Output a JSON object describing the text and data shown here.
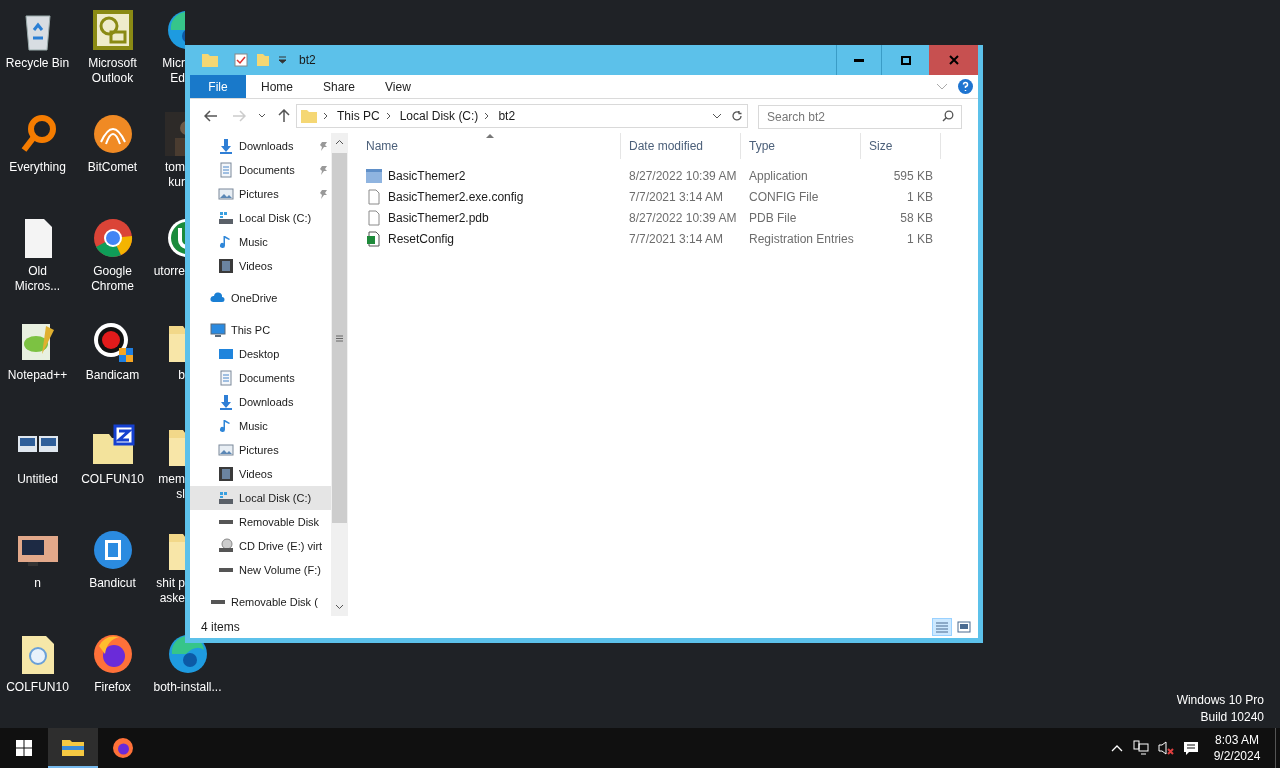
{
  "desktop": {
    "columns": [
      [
        {
          "kind": "recycle",
          "lines": [
            "Recycle Bin"
          ],
          "covered": false
        },
        {
          "kind": "everything",
          "lines": [
            "Everything"
          ],
          "covered": false
        },
        {
          "kind": "blank-doc",
          "lines": [
            "Old",
            "Micros..."
          ],
          "covered": false
        },
        {
          "kind": "notepad",
          "lines": [
            "Notepad++"
          ],
          "covered": false
        },
        {
          "kind": "screens",
          "lines": [
            "Untitled"
          ],
          "covered": false
        },
        {
          "kind": "tv",
          "lines": [
            "n"
          ],
          "covered": false
        },
        {
          "kind": "doc-folder",
          "lines": [
            "COLFUN10"
          ],
          "covered": false
        }
      ],
      [
        {
          "kind": "outlook",
          "lines": [
            "Microsoft",
            "Outlook"
          ],
          "covered": false
        },
        {
          "kind": "comet",
          "lines": [
            "BitComet"
          ],
          "covered": false
        },
        {
          "kind": "chrome",
          "lines": [
            "Google",
            "Chrome"
          ],
          "covered": false
        },
        {
          "kind": "bandicam",
          "lines": [
            "Bandicam"
          ],
          "covered": false
        },
        {
          "kind": "zip-folder",
          "lines": [
            "COLFUN10"
          ],
          "covered": false
        },
        {
          "kind": "bandicut",
          "lines": [
            "Bandicut"
          ],
          "covered": false
        },
        {
          "kind": "firefox",
          "lines": [
            "Firefox"
          ],
          "covered": false
        }
      ],
      [
        {
          "kind": "edge",
          "lines": [
            "Micr",
            "Ed"
          ],
          "covered": true
        },
        {
          "kind": "photo",
          "lines": [
            "tom",
            "kur"
          ],
          "covered": true
        },
        {
          "kind": "utorrent",
          "lines": [
            "utorre"
          ],
          "covered": true
        },
        {
          "kind": "folder",
          "lines": [
            "b"
          ],
          "covered": true
        },
        {
          "kind": "folder",
          "lines": [
            "mem",
            "sl"
          ],
          "covered": true
        },
        {
          "kind": "folder",
          "lines": [
            "shit p",
            "aske"
          ],
          "covered": true
        },
        {
          "kind": "edge",
          "lines": [
            "both-install..."
          ],
          "covered": false
        }
      ]
    ]
  },
  "window": {
    "title": "bt2",
    "active": true,
    "ribbon_tabs": [
      {
        "label": "File",
        "kind": "file"
      },
      {
        "label": "Home",
        "kind": "tab"
      },
      {
        "label": "Share",
        "kind": "tab"
      },
      {
        "label": "View",
        "kind": "tab"
      }
    ],
    "breadcrumb": [
      "This PC",
      "Local Disk (C:)",
      "bt2"
    ],
    "search": {
      "placeholder": "Search bt2"
    },
    "nav": {
      "quick_access": [
        {
          "label": "Downloads",
          "kind": "download",
          "pinned": true,
          "selected": false
        },
        {
          "label": "Documents",
          "kind": "document",
          "pinned": true,
          "selected": false
        },
        {
          "label": "Pictures",
          "kind": "pictures",
          "pinned": true,
          "selected": false
        },
        {
          "label": "Local Disk (C:)",
          "kind": "drive",
          "pinned": false,
          "selected": false
        },
        {
          "label": "Music",
          "kind": "music",
          "pinned": false,
          "selected": false
        },
        {
          "label": "Videos",
          "kind": "videos",
          "pinned": false,
          "selected": false
        }
      ],
      "tree": [
        {
          "label": "OneDrive",
          "kind": "cloud",
          "selected": false
        },
        {
          "label": "This PC",
          "kind": "pc",
          "selected": false,
          "children": [
            {
              "label": "Desktop",
              "kind": "desktop",
              "selected": false
            },
            {
              "label": "Documents",
              "kind": "document",
              "selected": false
            },
            {
              "label": "Downloads",
              "kind": "download",
              "selected": false
            },
            {
              "label": "Music",
              "kind": "music",
              "selected": false
            },
            {
              "label": "Pictures",
              "kind": "pictures",
              "selected": false
            },
            {
              "label": "Videos",
              "kind": "videos",
              "selected": false
            },
            {
              "label": "Local Disk (C:)",
              "kind": "drive",
              "selected": true
            },
            {
              "label": "Removable Disk",
              "kind": "removable",
              "selected": false
            },
            {
              "label": "CD Drive (E:) virt",
              "kind": "cd",
              "selected": false
            },
            {
              "label": "New Volume (F:)",
              "kind": "removable",
              "selected": false
            }
          ]
        },
        {
          "label": "Removable Disk (",
          "kind": "removable",
          "selected": false
        }
      ]
    },
    "table": {
      "columns": [
        "Name",
        "Date modified",
        "Type",
        "Size"
      ],
      "rows": [
        {
          "kind": "app",
          "name": "BasicThemer2",
          "date": "8/27/2022 10:39 AM",
          "type": "Application",
          "size": "595 KB"
        },
        {
          "kind": "file",
          "name": "BasicThemer2.exe.config",
          "date": "7/7/2021 3:14 AM",
          "type": "CONFIG File",
          "size": "1 KB"
        },
        {
          "kind": "file",
          "name": "BasicThemer2.pdb",
          "date": "8/27/2022 10:39 AM",
          "type": "PDB File",
          "size": "58 KB"
        },
        {
          "kind": "reg",
          "name": "ResetConfig",
          "date": "7/7/2021 3:14 AM",
          "type": "Registration Entries",
          "size": "1 KB"
        }
      ]
    },
    "status": "4 items",
    "views": [
      {
        "kind": "details",
        "selected": true
      },
      {
        "kind": "large",
        "selected": false
      }
    ]
  },
  "watermark_lines": [
    "Windows 10 Pro",
    "Build 10240"
  ],
  "taskbar": {
    "apps": [
      {
        "kind": "explorer",
        "selected": true
      },
      {
        "kind": "firefox",
        "selected": false
      }
    ],
    "time": "8:03 AM",
    "date": "9/2/2024"
  }
}
